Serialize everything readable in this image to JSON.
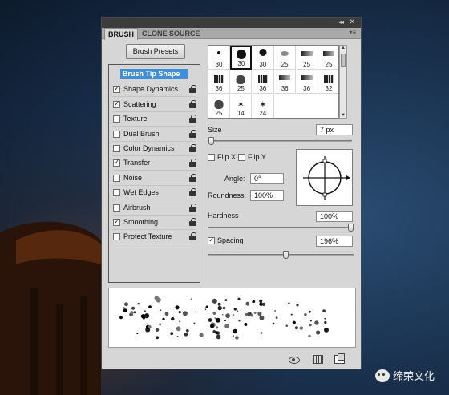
{
  "panel": {
    "tabs": [
      "BRUSH",
      "CLONE SOURCE"
    ],
    "collapse_glyph": "◂◂",
    "close_glyph": "✕",
    "menu_glyph": "▾≡"
  },
  "presets_button": "Brush Presets",
  "options": [
    {
      "label": "Brush Tip Shape",
      "checkbox": false,
      "checked": false,
      "lock": false,
      "active": true
    },
    {
      "label": "Shape Dynamics",
      "checkbox": true,
      "checked": true,
      "lock": true
    },
    {
      "label": "Scattering",
      "checkbox": true,
      "checked": true,
      "lock": true
    },
    {
      "label": "Texture",
      "checkbox": true,
      "checked": false,
      "lock": true
    },
    {
      "label": "Dual Brush",
      "checkbox": true,
      "checked": false,
      "lock": true
    },
    {
      "label": "Color Dynamics",
      "checkbox": true,
      "checked": false,
      "lock": true
    },
    {
      "label": "Transfer",
      "checkbox": true,
      "checked": true,
      "lock": true
    },
    {
      "label": "Noise",
      "checkbox": true,
      "checked": false,
      "lock": true
    },
    {
      "label": "Wet Edges",
      "checkbox": true,
      "checked": false,
      "lock": true
    },
    {
      "label": "Airbrush",
      "checkbox": true,
      "checked": false,
      "lock": true
    },
    {
      "label": "Smoothing",
      "checkbox": true,
      "checked": true,
      "lock": true
    },
    {
      "label": "Protect Texture",
      "checkbox": true,
      "checked": false,
      "lock": true
    }
  ],
  "brush_tips": [
    {
      "size": "30",
      "shape": "dot-sm"
    },
    {
      "size": "30",
      "shape": "dot-lg",
      "selected": true
    },
    {
      "size": "30",
      "shape": "dot-md"
    },
    {
      "size": "25",
      "shape": "oval"
    },
    {
      "size": "25",
      "shape": "stroke"
    },
    {
      "size": "25",
      "shape": "stroke"
    },
    {
      "size": "36",
      "shape": "chalk"
    },
    {
      "size": "25",
      "shape": "blob"
    },
    {
      "size": "36",
      "shape": "chalk"
    },
    {
      "size": "36",
      "shape": "stroke"
    },
    {
      "size": "36",
      "shape": "stroke"
    },
    {
      "size": "32",
      "shape": "chalk"
    },
    {
      "size": "25",
      "shape": "blob"
    },
    {
      "size": "14",
      "shape": "star"
    },
    {
      "size": "24",
      "shape": "star"
    }
  ],
  "size": {
    "label": "Size",
    "value": "7 px"
  },
  "flip_x": {
    "label": "Flip X",
    "checked": false
  },
  "flip_y": {
    "label": "Flip Y",
    "checked": false
  },
  "angle": {
    "label": "Angle:",
    "value": "0°"
  },
  "roundness": {
    "label": "Roundness:",
    "value": "100%"
  },
  "hardness": {
    "label": "Hardness",
    "value": "100%",
    "level": 1.0
  },
  "spacing": {
    "label": "Spacing",
    "value": "196%",
    "checked": true,
    "level": 0.196
  },
  "icons": [
    "toggle-live-tip-icon",
    "show-grid-icon",
    "create-new-brush-icon"
  ],
  "watermark": "缔荣文化"
}
